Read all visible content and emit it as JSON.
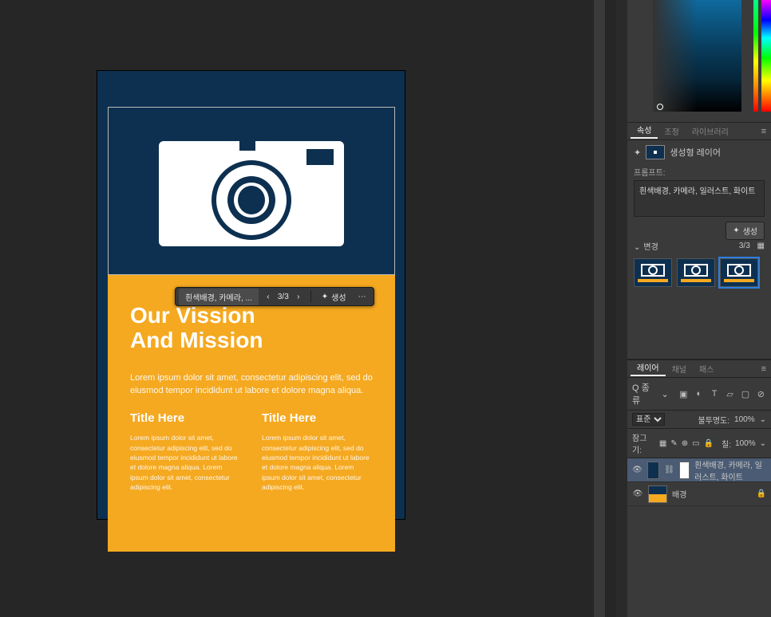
{
  "canvas": {
    "title_line1": "Our Vission",
    "title_line2": "And Mission",
    "lead": "Lorem ipsum dolor sit amet, consectetur adipiscing elit, sed do eiusmod tempor incididunt ut labore et dolore magna aliqua.",
    "col1_title": "Title Here",
    "col1_body": "Lorem ipsum dolor sit amet, consectetur adipiscing elit, sed do eiusmod tempor incididunt ut labore et dolore magna aliqua. Lorem ipsum dolor sit amet, consectetur adipiscing elit.",
    "col2_title": "Title Here",
    "col2_body": "Lorem ipsum dolor sit amet, consectetur adipiscing elit, sed do eiusmod tempor incididunt ut labore et dolore magna aliqua. Lorem ipsum dolor sit amet, consectetur adipiscing elit."
  },
  "ctx": {
    "chip": "흰색배경, 카메라, ...",
    "count": "3/3",
    "generate": "생성"
  },
  "tabs_props": {
    "t1": "속성",
    "t2": "조정",
    "t3": "라이브러리"
  },
  "properties": {
    "layer_label": "생성형 레이어",
    "prompt_label": "프롬프트:",
    "prompt_value": "흰색배경, 카메라, 일러스트, 화이트",
    "generate_btn": "생성",
    "variation_label": "변경",
    "variation_count": "3/3"
  },
  "tabs_layers": {
    "t1": "레이어",
    "t2": "채널",
    "t3": "패스"
  },
  "layers_opts": {
    "kind_label": "Q 종류",
    "blend": "표준",
    "opacity_label": "불투명도:",
    "opacity_value": "100%",
    "lock_label": "잠그기:",
    "fill_label": "칠:",
    "fill_value": "100%"
  },
  "layers": [
    {
      "name": "흰색배경, 카메라, 일러스트, 화이트",
      "selected": true,
      "locked": false,
      "is_gen": true
    },
    {
      "name": "배경",
      "selected": false,
      "locked": true,
      "is_gen": false
    }
  ]
}
